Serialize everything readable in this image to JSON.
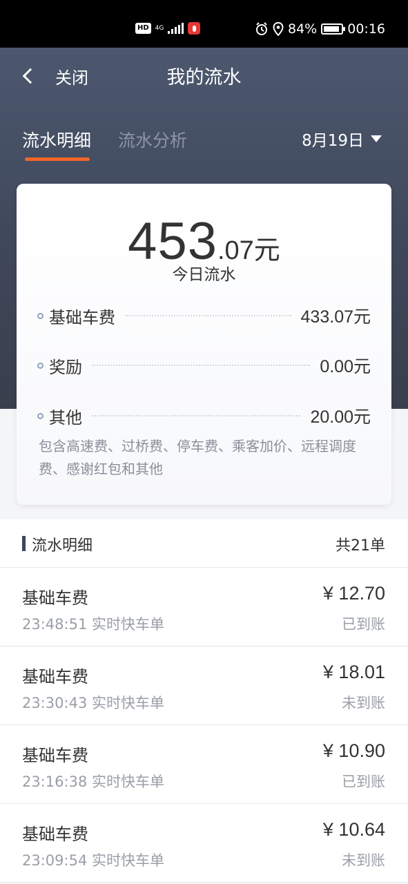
{
  "status_bar": {
    "hd": "HD",
    "network": "4G",
    "battery_percent": "84%",
    "time": "00:16",
    "battery_level": 0.84
  },
  "header": {
    "back_label": "关闭",
    "title": "我的流水"
  },
  "tabs": [
    {
      "label": "流水明细",
      "active": true
    },
    {
      "label": "流水分析",
      "active": false
    }
  ],
  "date_picker": {
    "label": "8月19日"
  },
  "summary": {
    "total_integer": "453",
    "total_decimal": ".07元",
    "total_label": "今日流水",
    "rows": [
      {
        "label": "基础车费",
        "value": "433.07元"
      },
      {
        "label": "奖励",
        "value": "0.00元"
      },
      {
        "label": "其他",
        "value": "20.00元"
      }
    ],
    "note": "包含高速费、过桥费、停车费、乘客加价、远程调度费、感谢红包和其他"
  },
  "section": {
    "title": "流水明细",
    "count": "共21单"
  },
  "transactions": [
    {
      "type": "基础车费",
      "meta": "23:48:51 实时快车单",
      "amount": "¥ 12.70",
      "status": "已到账"
    },
    {
      "type": "基础车费",
      "meta": "23:30:43 实时快车单",
      "amount": "¥ 18.01",
      "status": "未到账"
    },
    {
      "type": "基础车费",
      "meta": "23:16:38 实时快车单",
      "amount": "¥ 10.90",
      "status": "已到账"
    },
    {
      "type": "基础车费",
      "meta": "23:09:54 实时快车单",
      "amount": "¥ 10.64",
      "status": "未到账"
    }
  ],
  "colors": {
    "header_bg": "#4c586f",
    "accent": "#f2662a",
    "muted_text": "#9a9ea6"
  },
  "icons": {
    "back": "chevron-left-icon",
    "date_dropdown": "caret-down-icon",
    "alarm": "alarm-icon",
    "location": "location-icon",
    "mic": "mic-icon"
  }
}
